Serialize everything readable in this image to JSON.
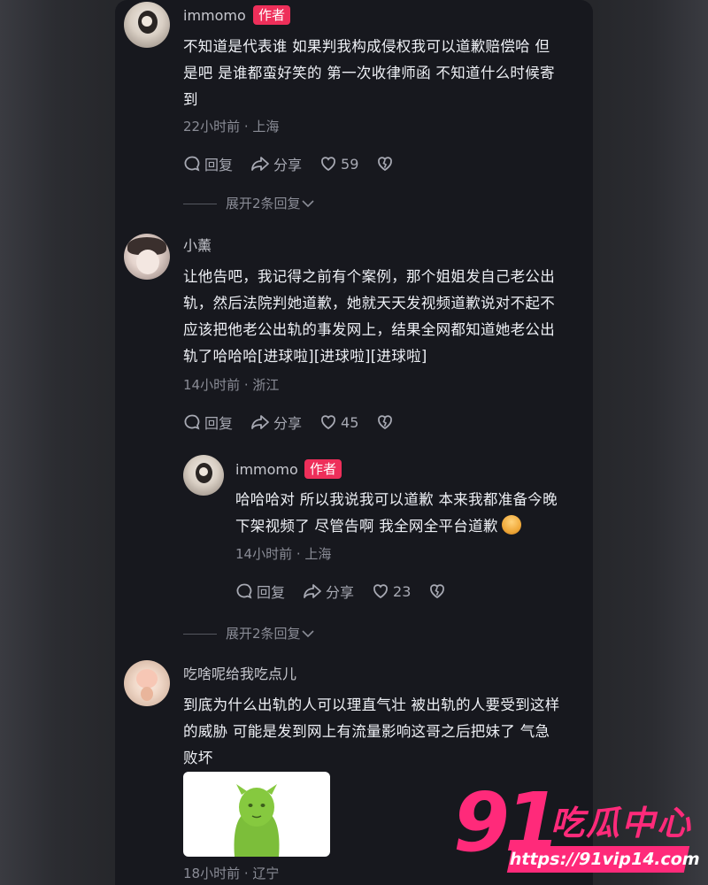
{
  "comments": [
    {
      "username": "immomo",
      "badge": "作者",
      "lines": [
        "不知道是代表谁 如果判我构成侵权我可以道歉赔偿哈 但",
        "是吧 是谁都蛮好笑的 第一次收律师函 不知道什么时候寄",
        "到"
      ],
      "meta": "22小时前 · 上海",
      "reply_label": "回复",
      "share_label": "分享",
      "likes": "59"
    },
    {
      "username": "小薰",
      "lines": [
        "让他告吧，我记得之前有个案例，那个姐姐发自己老公出",
        "轨，然后法院判她道歉，她就天天发视频道歉说对不起不",
        "应该把他老公出轨的事发网上，结果全网都知道她老公出",
        "轨了哈哈哈[进球啦][进球啦][进球啦]"
      ],
      "meta": "14小时前 · 浙江",
      "reply_label": "回复",
      "share_label": "分享",
      "likes": "45"
    },
    {
      "username": "immomo",
      "badge": "作者",
      "lines": [
        "哈哈哈对 所以我说我可以道歉 本来我都准备今晚",
        "下架视频了 尽管告啊 我全网全平台道歉"
      ],
      "meta": "14小时前 · 上海",
      "reply_label": "回复",
      "share_label": "分享",
      "likes": "23"
    },
    {
      "username": "吃啥呢给我吃点儿",
      "lines": [
        "到底为什么出轨的人可以理直气壮 被出轨的人要受到这样",
        "的威胁 可能是发到网上有流量影响这哥之后把妹了 气急",
        "败坏"
      ],
      "meta": "18小时前 · 辽宁"
    }
  ],
  "expand_replies": [
    "展开2条回复",
    "展开2条回复"
  ],
  "watermark": {
    "number": "91",
    "name": "吃瓜中心",
    "url": "https://91vip14.com"
  },
  "colors": {
    "accent": "#ee2f5a",
    "watermark": "#ff2a7a",
    "panel": "#17181e"
  }
}
